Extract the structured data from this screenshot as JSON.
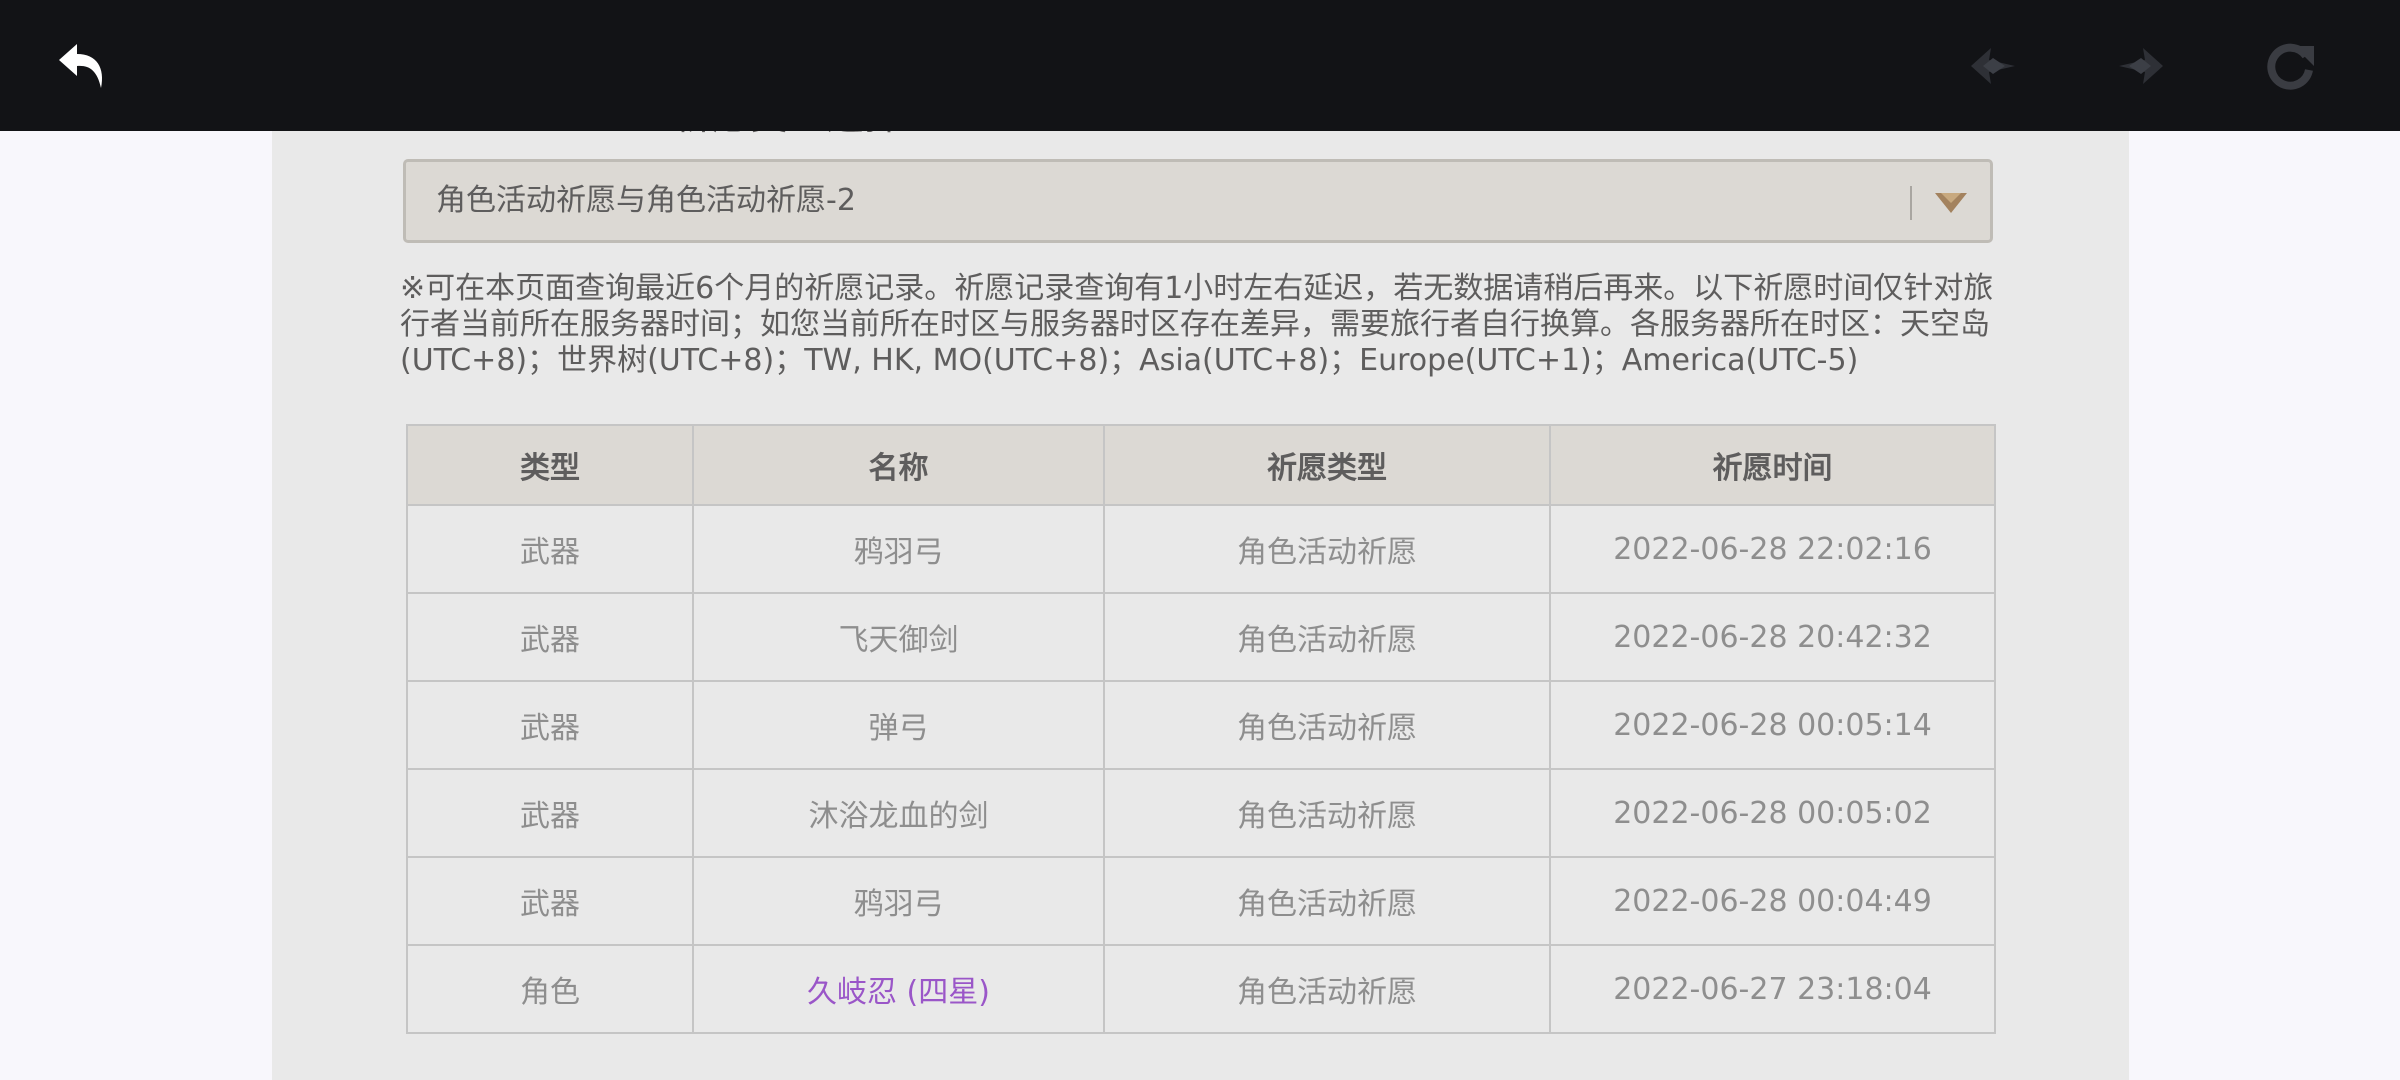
{
  "page": {
    "background": "#f8f7fc",
    "panel_color": "#e9e9e9"
  },
  "topbar": {
    "background": "#121316",
    "back_icon": "back-arrow-icon",
    "prev_icon": "prev-page-icon",
    "next_icon": "next-page-icon",
    "refresh_icon": "refresh-icon"
  },
  "wish_type_select": {
    "cut_label": "祈愿类型选择:",
    "value": "角色活动祈愿与角色活动祈愿-2",
    "arrow_icon": "chevron-down-icon",
    "arrow_color": "#a3825e"
  },
  "notice": "※可在本页面查询最近6个月的祈愿记录。祈愿记录查询有1小时左右延迟，若无数据请稍后再来。以下祈愿时间仅针对旅行者当前所在服务器时间；如您当前所在时区与服务器时区存在差异，需要旅行者自行换算。各服务器所在时区：天空岛(UTC+8)；世界树(UTC+8)；TW, HK, MO(UTC+8)；Asia(UTC+8)；Europe(UTC+1)；America(UTC-5)",
  "table": {
    "headers": [
      "类型",
      "名称",
      "祈愿类型",
      "祈愿时间"
    ],
    "rows": [
      {
        "type": "武器",
        "name": "鸦羽弓",
        "wish": "角色活动祈愿",
        "time": "2022-06-28 22:02:16"
      },
      {
        "type": "武器",
        "name": "飞天御剑",
        "wish": "角色活动祈愿",
        "time": "2022-06-28 20:42:32"
      },
      {
        "type": "武器",
        "name": "弹弓",
        "wish": "角色活动祈愿",
        "time": "2022-06-28 00:05:14"
      },
      {
        "type": "武器",
        "name": "沐浴龙血的剑",
        "wish": "角色活动祈愿",
        "time": "2022-06-28 00:05:02"
      },
      {
        "type": "武器",
        "name": "鸦羽弓",
        "wish": "角色活动祈愿",
        "time": "2022-06-28 00:04:49"
      },
      {
        "type": "角色",
        "name": "久岐忍 (四星)",
        "wish": "角色活动祈愿",
        "time": "2022-06-27 23:18:04"
      }
    ],
    "four_star_color": "#9a56c8"
  }
}
